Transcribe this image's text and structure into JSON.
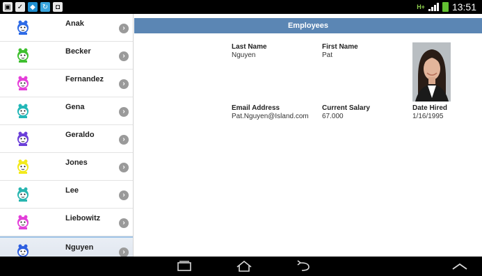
{
  "status_bar": {
    "network_type": "H+",
    "time": "13:51"
  },
  "header": {
    "title": "Employees"
  },
  "employees": [
    {
      "name": "Anak",
      "avatar_color": "#2e6be6"
    },
    {
      "name": "Becker",
      "avatar_color": "#3fbf2f"
    },
    {
      "name": "Fernandez",
      "avatar_color": "#e53fd9"
    },
    {
      "name": "Gena",
      "avatar_color": "#23b7b7"
    },
    {
      "name": "Geraldo",
      "avatar_color": "#6b3fd9"
    },
    {
      "name": "Jones",
      "avatar_color": "#f2ea1c"
    },
    {
      "name": "Lee",
      "avatar_color": "#28b5b0"
    },
    {
      "name": "Liebowitz",
      "avatar_color": "#e33fd9"
    },
    {
      "name": "Nguyen",
      "avatar_color": "#2e5fe0"
    }
  ],
  "selected_index": 8,
  "detail": {
    "last_name_label": "Last Name",
    "last_name": "Nguyen",
    "first_name_label": "First Name",
    "first_name": "Pat",
    "email_label": "Email Address",
    "email": "Pat.Nguyen@Island.com",
    "salary_label": "Current Salary",
    "salary": "67.000",
    "date_hired_label": "Date Hired",
    "date_hired": "1/16/1995"
  },
  "colors": {
    "header_bg": "#5b86b4",
    "selected_row": "#e4e9f1"
  }
}
